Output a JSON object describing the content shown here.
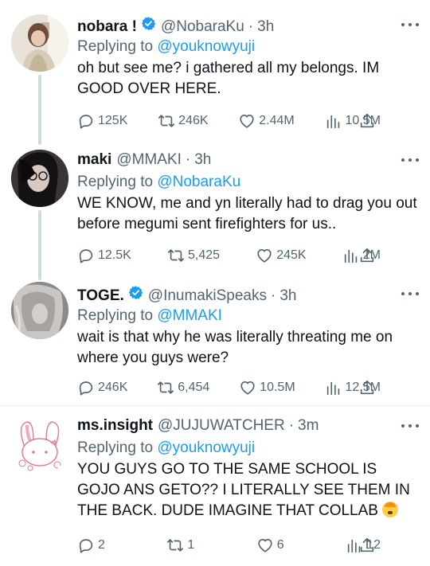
{
  "tweets": [
    {
      "name": "nobara !",
      "verified": true,
      "handle": "@NobaraKu",
      "time": "3h",
      "replying_label": "Replying to",
      "replying_to": "@youknowyuji",
      "text": "oh but see me? i gathered all my belongs. IM GOOD OVER HERE.",
      "replies": "125K",
      "retweets": "246K",
      "likes": "2.44M",
      "views": "10.5M"
    },
    {
      "name": "maki",
      "verified": false,
      "handle": "@MMAKI",
      "time": "3h",
      "replying_label": "Replying to",
      "replying_to": "@NobaraKu",
      "text": "WE KNOW, me and yn literally had to drag you out before megumi sent firefighters for us..",
      "replies": "12.5K",
      "retweets": "5,425",
      "likes": "245K",
      "views": "2M"
    },
    {
      "name": "TOGE.",
      "verified": true,
      "handle": "@InumakiSpeaks",
      "time": "3h",
      "replying_label": "Replying to",
      "replying_to": "@MMAKI",
      "text": "wait is that why he was literally threating me on where you guys were?",
      "replies": "246K",
      "retweets": "6,454",
      "likes": "10.5M",
      "views": "12.5M"
    },
    {
      "name": "ms.insight",
      "verified": false,
      "handle": "@JUJUWATCHER",
      "time": "3m",
      "replying_label": "Replying to",
      "replying_to": "@youknowyuji",
      "text": "YOU GUYS GO TO THE SAME SCHOOL IS GOJO ANS GETO?? I LITERALLY SEE THEM IN THE BACK. DUDE IMAGINE THAT COLLAB",
      "emoji": "exploding-head-emoji",
      "replies": "2",
      "retweets": "1",
      "likes": "6",
      "views": "12"
    }
  ],
  "icons": {
    "reply": "comment-icon",
    "retweet": "retweet-icon",
    "like": "heart-icon",
    "views": "bar-chart-icon",
    "share": "share-icon",
    "more": "more-dots-icon",
    "verified": "verified-badge-icon"
  },
  "colors": {
    "link": "#1d9bf0",
    "secondary_text": "#536471",
    "thread_line": "#cfd9de",
    "verified": "#1d9bf0"
  }
}
